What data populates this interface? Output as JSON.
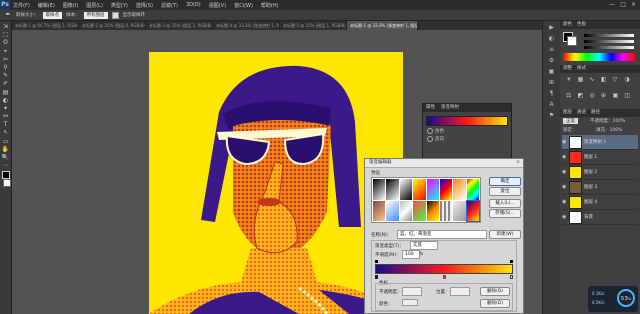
{
  "app": {
    "logo": "Ps"
  },
  "menu": [
    "文件(F)",
    "编辑(E)",
    "图像(I)",
    "图层(L)",
    "类型(Y)",
    "选择(S)",
    "滤镜(T)",
    "3D(D)",
    "视图(V)",
    "窗口(W)",
    "帮助(H)"
  ],
  "window_controls": [
    "—",
    "□",
    "×"
  ],
  "options_bar": {
    "size_label": "取样大小：",
    "size_value": "取样点",
    "sample_label": "样本：",
    "sample_value": "所有图层",
    "show_ring_label": "显示取样环"
  },
  "doc_tabs": [
    {
      "label": "未标题-1 @ 66.7% (图层 1, RGB/8)",
      "active": false
    },
    {
      "label": "未标题-2 @ 25% (图层 0, RGB/8)",
      "active": false
    },
    {
      "label": "未标题-3 @ 25% (图层 2, RGB/8)",
      "active": false
    },
    {
      "label": "未标题-4 @ 33.3% (渐变映射 1, RGB/8)",
      "active": false
    },
    {
      "label": "未标题-5 @ 25% (图层 1, RGB/8)",
      "active": false
    },
    {
      "label": "未标题-1 @ 33.3% (渐变映射 1, 图层蒙版/8)",
      "active": true
    }
  ],
  "tools": [
    "⇲",
    "⬚",
    "ʘ",
    "⌖",
    "✂",
    "⚲",
    "✎",
    "✐",
    "▤",
    "◐",
    "✦",
    "⚯",
    "T",
    "↖",
    "▭",
    "✋",
    "🔍",
    "⋯"
  ],
  "right_icons": [
    "▶",
    "◐",
    "≡",
    "⚙",
    "▣",
    "⊞",
    "¶",
    "A",
    "⚑"
  ],
  "panels": {
    "color_tabs": [
      "颜色",
      "色板"
    ],
    "adjust_tabs": [
      "调整",
      "样式"
    ],
    "layer_tabs": [
      "图层",
      "通道",
      "路径"
    ],
    "blend_mode": "正常",
    "opacity_label": "不透明度：100%",
    "lock_label": "锁定：",
    "fill_label": "填充：100%",
    "layers": [
      {
        "name": "渐变映射 1",
        "selected": true,
        "thumb": "#ffffff"
      },
      {
        "name": "图层 1",
        "selected": false,
        "thumb": "#ff2a1a"
      },
      {
        "name": "图层 2",
        "selected": false,
        "thumb": "#ffe600"
      },
      {
        "name": "图层 3",
        "selected": false,
        "thumb": "#7a5a3a"
      },
      {
        "name": "图层 4",
        "selected": false,
        "thumb": "#ffe600"
      },
      {
        "name": "背景",
        "selected": false,
        "thumb": "#ffffff"
      }
    ]
  },
  "properties": {
    "tabs": [
      "属性",
      "渐变映射"
    ],
    "options": [
      "仿色",
      "反向"
    ]
  },
  "dialog": {
    "title": "渐变编辑器",
    "presets_label": "预设",
    "buttons": [
      "确定",
      "复位",
      "载入(L)...",
      "存储(S)..."
    ],
    "name_label": "名称(N)：",
    "name_value": "蓝，红，黄渐变",
    "new_button": "新建(W)",
    "type_label": "渐变类型(T)：",
    "type_value": "实底",
    "smooth_label": "平滑度(M)：",
    "smooth_value": "100",
    "percent": "%",
    "stops_label": "色标",
    "opacity_label": "不透明度：",
    "location_label": "位置：",
    "delete_label": "删除(D)",
    "color_label": "颜色："
  },
  "hud": {
    "value": "53",
    "unit": "%",
    "up": "0.1K/s",
    "down": "0.5K/s"
  },
  "colors": {
    "canvas_bg": "#ffe600",
    "duotone_dark": "#3a1a8a",
    "gradient": [
      "#1a0a8c",
      "#ff1a1a",
      "#ffe600"
    ]
  }
}
